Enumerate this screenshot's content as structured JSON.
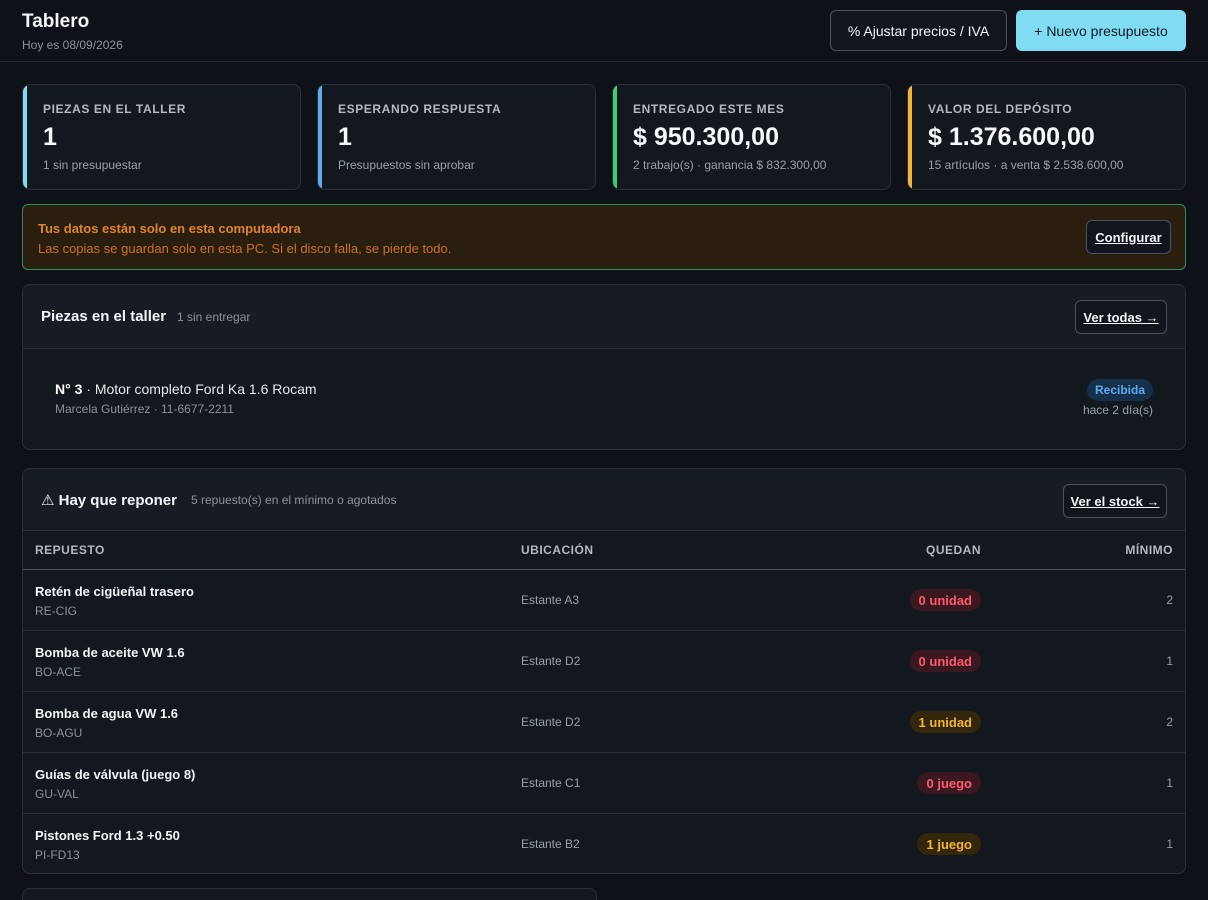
{
  "header": {
    "title": "Tablero",
    "date": "Hoy es 08/09/2026",
    "adjust_label": "% Ajustar precios / IVA",
    "new_label": "+ Nuevo presupuesto"
  },
  "stats": [
    {
      "label": "PIEZAS EN EL TALLER",
      "value": "1",
      "sub": "1 sin presupuestar",
      "color": "#7fdcf2"
    },
    {
      "label": "ESPERANDO RESPUESTA",
      "value": "1",
      "sub": "Presupuestos sin aprobar",
      "color": "#5fa9f0"
    },
    {
      "label": "ENTREGADO ESTE MES",
      "value": "$ 950.300,00",
      "sub": "2 trabajo(s) · ganancia $ 832.300,00",
      "color": "#3ccf6e"
    },
    {
      "label": "VALOR DEL DEPÓSITO",
      "value": "$ 1.376.600,00",
      "sub": "15 artículos · a venta $ 2.538.600,00",
      "color": "#f2b53a"
    }
  ],
  "warning": {
    "title": "Tus datos están solo en esta computadora",
    "text": "Las copias se guardan solo en esta PC. Si el disco falla, se pierde todo.",
    "button": "Configurar"
  },
  "workshop": {
    "title": "Piezas en el taller",
    "sub": "1 sin entregar",
    "button": "Ver todas →",
    "job": {
      "number": "N° 3",
      "description": " · Motor completo Ford Ka 1.6 Rocam",
      "client": "Marcela Gutiérrez · 11-6677-2211",
      "status": "Recibida",
      "time": "hace 2 día(s)"
    }
  },
  "restock": {
    "icon": "warning-icon",
    "title": "⚠ Hay que reponer",
    "sub": "5 repuesto(s) en el mínimo o agotados",
    "button": "Ver el stock →",
    "columns": [
      "REPUESTO",
      "UBICACIÓN",
      "QUEDAN",
      "MÍNIMO"
    ],
    "rows": [
      {
        "name": "Retén de cigüeñal trasero",
        "code": "RE-CIG",
        "location": "Estante A3",
        "left": "0 unidad",
        "status": "red",
        "min": "2"
      },
      {
        "name": "Bomba de aceite VW 1.6",
        "code": "BO-ACE",
        "location": "Estante D2",
        "left": "0 unidad",
        "status": "red",
        "min": "1"
      },
      {
        "name": "Bomba de agua VW 1.6",
        "code": "BO-AGU",
        "location": "Estante D2",
        "left": "1 unidad",
        "status": "amber",
        "min": "2"
      },
      {
        "name": "Guías de válvula (juego 8)",
        "code": "GU-VAL",
        "location": "Estante C1",
        "left": "0 juego",
        "status": "red",
        "min": "1"
      },
      {
        "name": "Pistones Ford 1.3 +0.50",
        "code": "PI-FD13",
        "location": "Estante B2",
        "left": "1 juego",
        "status": "amber",
        "min": "1"
      }
    ]
  }
}
